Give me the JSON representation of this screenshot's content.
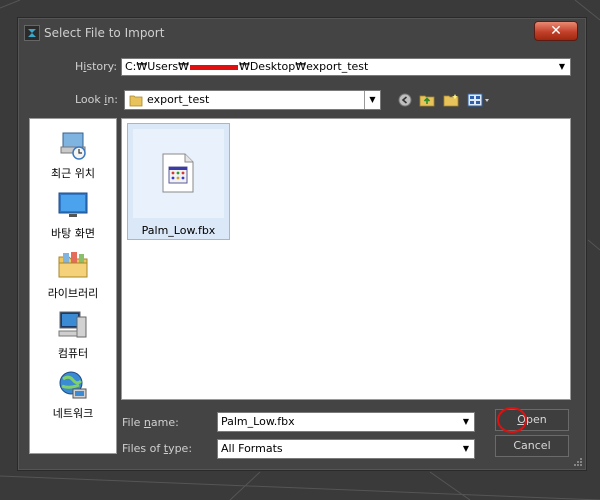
{
  "dialog": {
    "title": "Select File to Import",
    "close_label": "✕"
  },
  "history": {
    "label_pre": "H",
    "label_ul": "i",
    "label_post": "story:",
    "path_pre": "C:₩Users₩",
    "path_post": "₩Desktop₩export_test"
  },
  "lookin": {
    "label_pre": "Look ",
    "label_ul": "i",
    "label_post": "n:",
    "value": "export_test"
  },
  "toolbar": {
    "icons": [
      "back-icon",
      "up-folder-icon",
      "new-folder-icon",
      "view-menu-icon"
    ]
  },
  "places": [
    {
      "label": "최근 위치",
      "icon": "recent-places-icon"
    },
    {
      "label": "바탕 화면",
      "icon": "desktop-icon"
    },
    {
      "label": "라이브러리",
      "icon": "libraries-icon"
    },
    {
      "label": "컴퓨터",
      "icon": "computer-icon"
    },
    {
      "label": "네트워크",
      "icon": "network-icon"
    }
  ],
  "files": [
    {
      "name": "Palm_Low.fbx",
      "icon": "fbx-file-icon",
      "selected": true
    }
  ],
  "filename": {
    "label_pre": "File ",
    "label_ul": "n",
    "label_post": "ame:",
    "value": "Palm_Low.fbx"
  },
  "filetype": {
    "label_pre": "Files of ",
    "label_ul": "t",
    "label_post": "ype:",
    "value": "All Formats"
  },
  "buttons": {
    "open_ul": "O",
    "open_post": "pen",
    "cancel": "Cancel"
  },
  "colors": {
    "dialog_bg": "#444444",
    "close_red": "#c2402a",
    "selection": "#dbe8f8",
    "annotation": "#e01010"
  }
}
